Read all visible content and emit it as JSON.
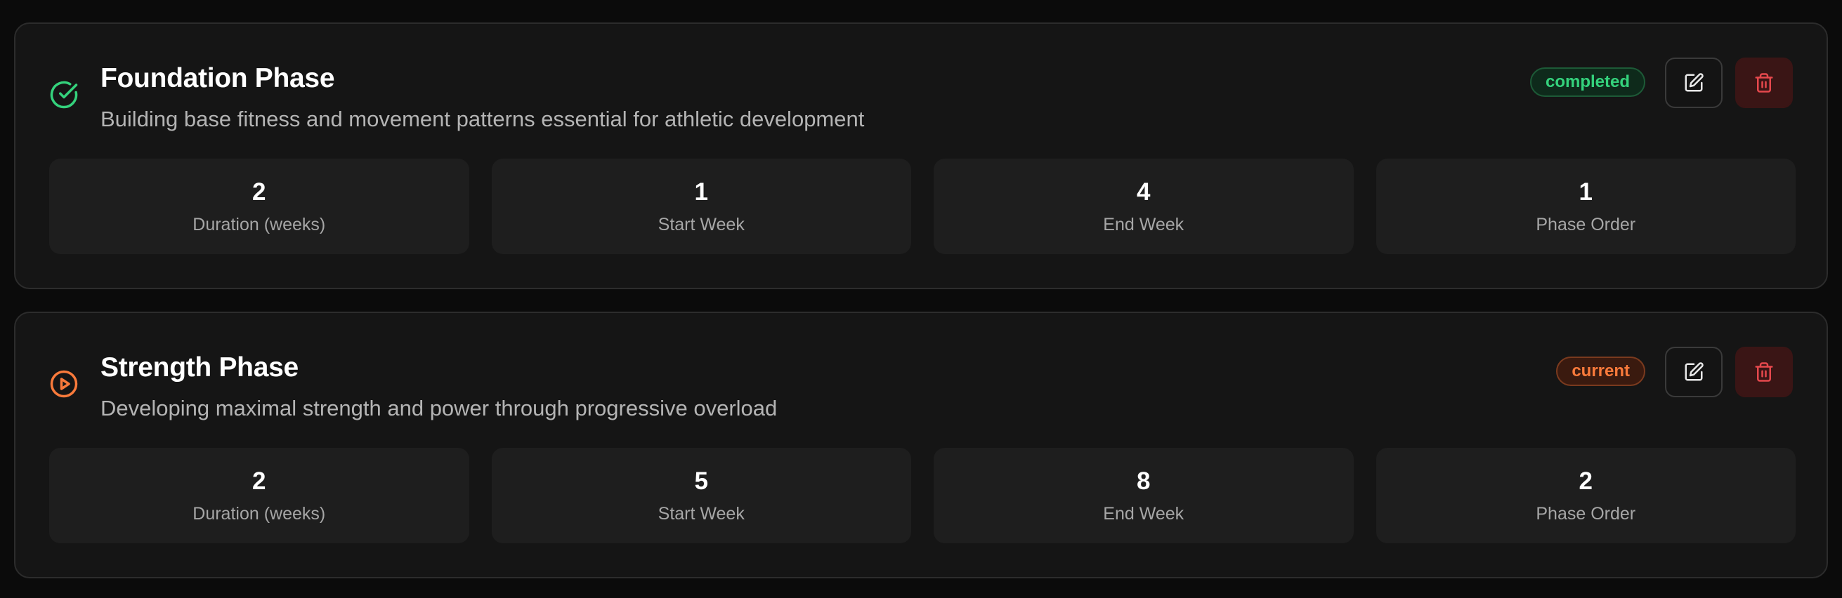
{
  "colors": {
    "page_background": "#0b0b0b",
    "card_background": "#151515",
    "stat_background": "#1e1e1e",
    "completed_accent": "#34d27c",
    "current_accent": "#f97a3b",
    "delete_accent": "#e5484d"
  },
  "phases": [
    {
      "status_icon": "check-circle-icon",
      "title": "Foundation Phase",
      "description": "Building base fitness and movement patterns essential for athletic development",
      "status": "completed",
      "edit_icon": "edit-icon",
      "delete_icon": "trash-icon",
      "stats": [
        {
          "value": "2",
          "label": "Duration (weeks)"
        },
        {
          "value": "1",
          "label": "Start Week"
        },
        {
          "value": "4",
          "label": "End Week"
        },
        {
          "value": "1",
          "label": "Phase Order"
        }
      ]
    },
    {
      "status_icon": "play-circle-icon",
      "title": "Strength Phase",
      "description": "Developing maximal strength and power through progressive overload",
      "status": "current",
      "edit_icon": "edit-icon",
      "delete_icon": "trash-icon",
      "stats": [
        {
          "value": "2",
          "label": "Duration (weeks)"
        },
        {
          "value": "5",
          "label": "Start Week"
        },
        {
          "value": "8",
          "label": "End Week"
        },
        {
          "value": "2",
          "label": "Phase Order"
        }
      ]
    }
  ]
}
